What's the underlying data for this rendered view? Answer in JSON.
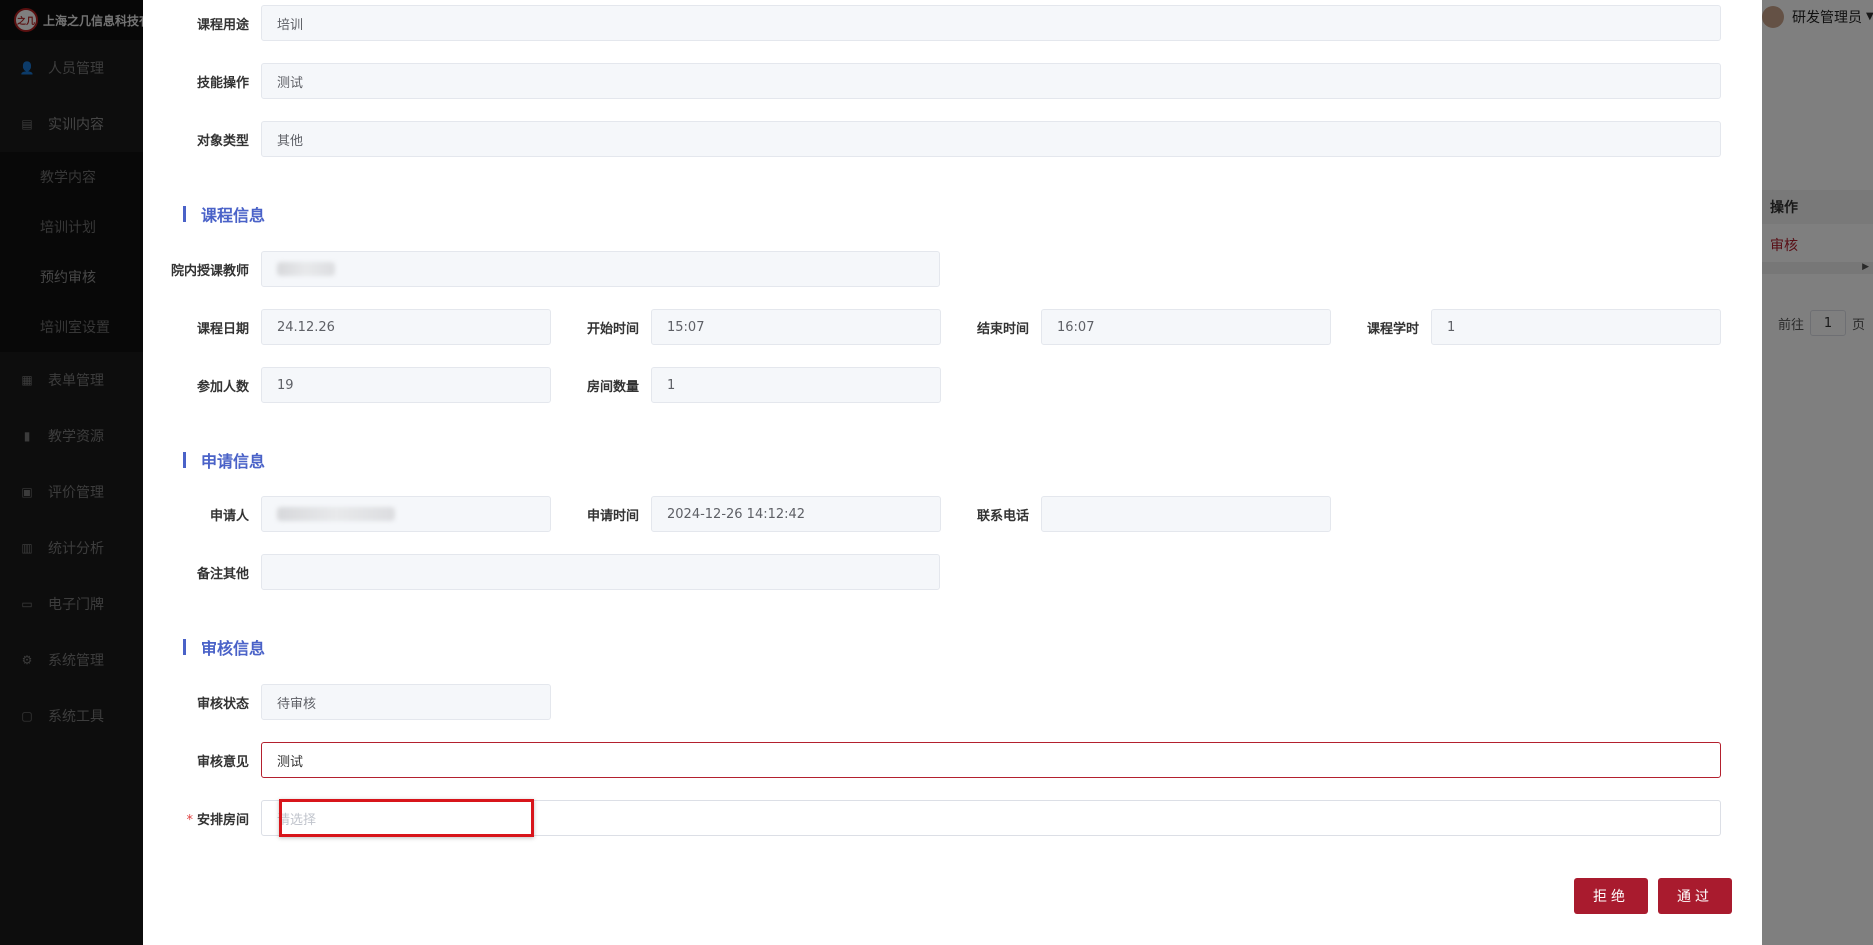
{
  "brand": {
    "logo_text": "之几",
    "name": "上海之几信息科技有限公司"
  },
  "sidebar": {
    "items": [
      {
        "label": "人员管理",
        "icon": "user-icon"
      },
      {
        "label": "实训内容",
        "icon": "document-icon"
      },
      {
        "label": "表单管理",
        "icon": "form-icon"
      },
      {
        "label": "教学资源",
        "icon": "book-icon"
      },
      {
        "label": "评价管理",
        "icon": "rating-icon"
      },
      {
        "label": "统计分析",
        "icon": "chart-icon"
      },
      {
        "label": "电子门牌",
        "icon": "monitor-icon"
      },
      {
        "label": "系统管理",
        "icon": "gear-icon"
      },
      {
        "label": "系统工具",
        "icon": "toolbox-icon"
      }
    ],
    "submenu": [
      "教学内容",
      "培训计划",
      "预约审核",
      "培训室设置"
    ]
  },
  "header": {
    "user_name": "研发管理员"
  },
  "background_table": {
    "op_header": "操作",
    "op_link": "审核",
    "pager_prefix": "前往",
    "pager_page": "1",
    "pager_suffix": "页"
  },
  "form": {
    "course_purpose": {
      "label": "课程用途",
      "value": "培训"
    },
    "skill_operation": {
      "label": "技能操作",
      "value": "测试"
    },
    "object_type": {
      "label": "对象类型",
      "value": "其他"
    },
    "section_course": "课程信息",
    "teacher": {
      "label": "院内授课教师"
    },
    "course_date": {
      "label": "课程日期",
      "value": "24.12.26"
    },
    "start_time": {
      "label": "开始时间",
      "value": "15:07"
    },
    "end_time": {
      "label": "结束时间",
      "value": "16:07"
    },
    "course_hours": {
      "label": "课程学时",
      "value": "1"
    },
    "participants": {
      "label": "参加人数",
      "value": "19"
    },
    "room_count": {
      "label": "房间数量",
      "value": "1"
    },
    "section_apply": "申请信息",
    "applicant": {
      "label": "申请人"
    },
    "apply_time": {
      "label": "申请时间",
      "value": "2024-12-26 14:12:42"
    },
    "phone": {
      "label": "联系电话",
      "value": ""
    },
    "remarks": {
      "label": "备注其他",
      "value": ""
    },
    "section_review": "审核信息",
    "review_status": {
      "label": "审核状态",
      "value": "待审核"
    },
    "review_opinion": {
      "label": "审核意见",
      "value": "测试"
    },
    "arrange_room": {
      "label": "安排房间",
      "placeholder": "请选择",
      "required_mark": "*"
    }
  },
  "buttons": {
    "reject": "拒绝",
    "approve": "通过"
  },
  "colors": {
    "accent": "#a91b2e",
    "section": "#4a62c8",
    "sidebar_bg": "#1a1a1a"
  }
}
